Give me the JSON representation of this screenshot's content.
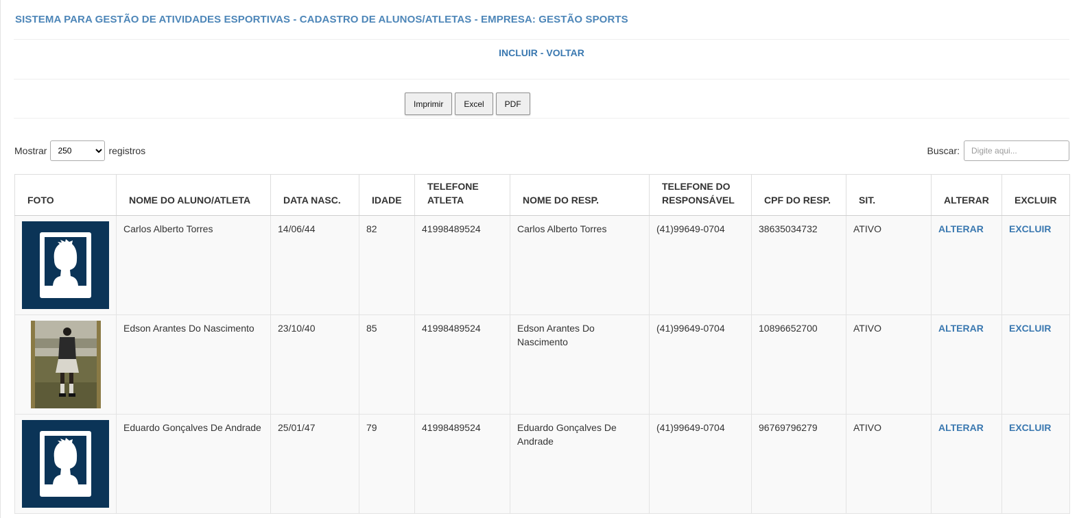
{
  "header": {
    "title": "SISTEMA PARA GESTÃO DE ATIVIDADES ESPORTIVAS - CADASTRO DE ALUNOS/ATLETAS - EMPRESA: GESTÃO SPORTS"
  },
  "nav": {
    "incluir": "INCLUIR",
    "separator": " - ",
    "voltar": "VOLTAR"
  },
  "export": {
    "print": "Imprimir",
    "excel": "Excel",
    "pdf": "PDF"
  },
  "length": {
    "prefix": "Mostrar",
    "selected": "250",
    "suffix": "registros"
  },
  "search": {
    "label": "Buscar:",
    "placeholder": "Digite aqui..."
  },
  "colors": {
    "title": "#4d86b8",
    "link": "#3a78b0",
    "avatar_bg": "#0b3457"
  },
  "table": {
    "columns": [
      "FOTO",
      "NOME DO ALUNO/ATLETA",
      "DATA NASC.",
      "IDADE",
      "TELEFONE ATLETA",
      "NOME DO RESP.",
      "TELEFONE DO RESPONSÁVEL",
      "CPF DO RESP.",
      "SIT.",
      "ALTERAR",
      "EXCLUIR"
    ],
    "rows": [
      {
        "photo": "default-avatar-icon",
        "nome": "Carlos Alberto Torres",
        "data_nasc": "14/06/44",
        "idade": "82",
        "telefone_atleta": "41998489524",
        "nome_resp": "Carlos Alberto Torres",
        "telefone_resp": "(41)99649-0704",
        "cpf_resp": "38635034732",
        "sit": "ATIVO",
        "alterar": "ALTERAR",
        "excluir": "EXCLUIR"
      },
      {
        "photo": "athlete-photo",
        "nome": "Edson Arantes Do Nascimento",
        "data_nasc": "23/10/40",
        "idade": "85",
        "telefone_atleta": "41998489524",
        "nome_resp": "Edson Arantes Do Nascimento",
        "telefone_resp": "(41)99649-0704",
        "cpf_resp": "10896652700",
        "sit": "ATIVO",
        "alterar": "ALTERAR",
        "excluir": "EXCLUIR"
      },
      {
        "photo": "default-avatar-icon",
        "nome": "Eduardo Gonçalves De Andrade",
        "data_nasc": "25/01/47",
        "idade": "79",
        "telefone_atleta": "41998489524",
        "nome_resp": "Eduardo Gonçalves De Andrade",
        "telefone_resp": "(41)99649-0704",
        "cpf_resp": "96769796279",
        "sit": "ATIVO",
        "alterar": "ALTERAR",
        "excluir": "EXCLUIR"
      }
    ]
  }
}
